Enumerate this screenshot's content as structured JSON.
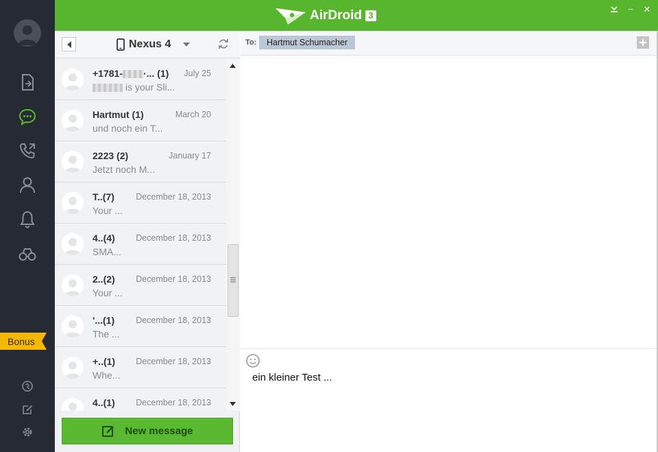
{
  "app": {
    "logo_text": "AirDroid",
    "logo_version": "3"
  },
  "window_controls": {
    "minimize": "−",
    "close": "✕"
  },
  "sidebar": {
    "items": [
      {
        "name": "file-transfer-icon"
      },
      {
        "name": "messages-icon",
        "active": true
      },
      {
        "name": "calls-icon"
      },
      {
        "name": "contacts-icon"
      },
      {
        "name": "notifications-icon"
      },
      {
        "name": "find-phone-icon"
      }
    ],
    "bonus_label": "Bonus",
    "bottom_icons": [
      "web-icon",
      "edit-icon",
      "settings-icon"
    ]
  },
  "device_bar": {
    "device_name": "Nexus 4"
  },
  "conversations": [
    {
      "name": "+1781-",
      "name_suffix": "·... (1)",
      "date": "July 25",
      "preview_suffix": " is your Sli..."
    },
    {
      "name": "Hartmut  (1)",
      "date": "March 20",
      "preview": "und noch ein T..."
    },
    {
      "name": "2223  (2)",
      "date": "January 17",
      "preview": "Jetzt noch M..."
    },
    {
      "name": "T..(7)",
      "date": "December 18, 2013",
      "preview": "Your ..."
    },
    {
      "name": "4..(4)",
      "date": "December 18, 2013",
      "preview": "SMA..."
    },
    {
      "name": "2..(2)",
      "date": "December 18, 2013",
      "preview": "Your ..."
    },
    {
      "name": "'...(1)",
      "date": "December 18, 2013",
      "preview": "The ..."
    },
    {
      "name": "+..(1)",
      "date": "December 18, 2013",
      "preview": "Whe..."
    },
    {
      "name": "4..(1)",
      "date": "December 18, 2013",
      "preview": ""
    }
  ],
  "new_message_label": "New message",
  "recipient": {
    "to_label": "To:",
    "name": "Hartmut Schumacher"
  },
  "compose": {
    "text": "ein kleiner Test ..."
  },
  "colors": {
    "accent": "#58b62e",
    "sidebar_bg": "#262a33",
    "active_icon": "#5ab930",
    "bonus": "#f5b800"
  }
}
